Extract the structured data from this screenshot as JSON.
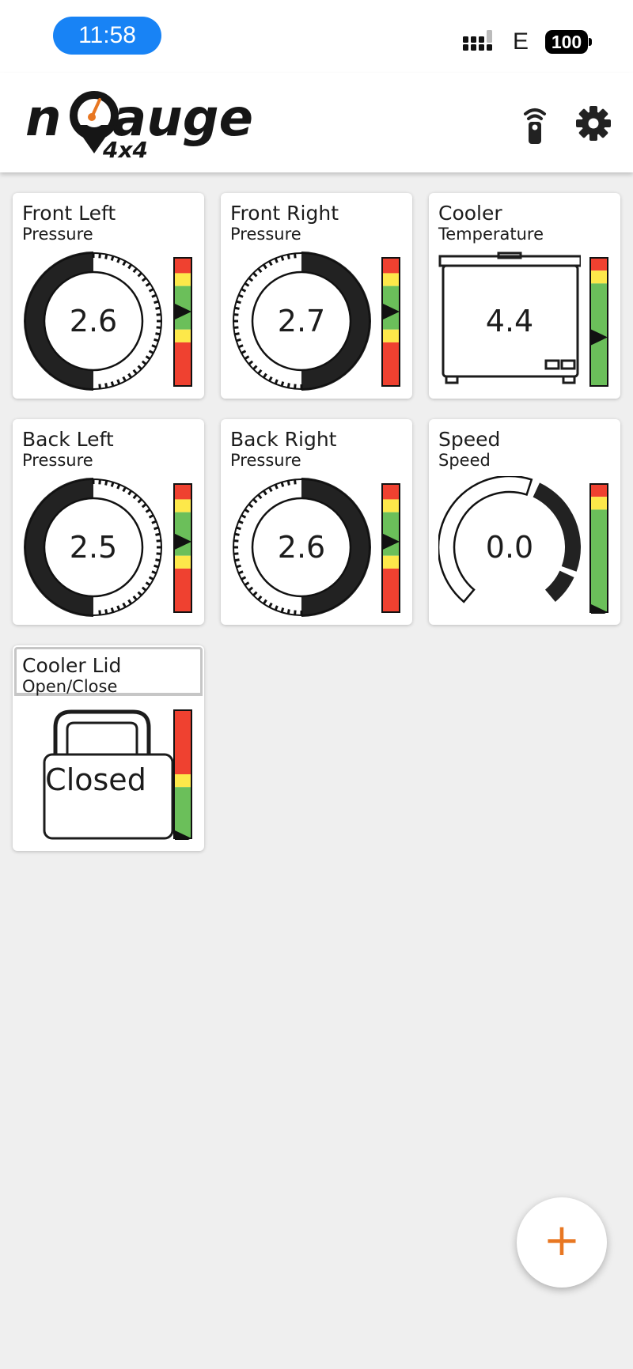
{
  "status_bar": {
    "time": "11:58",
    "network": "E",
    "battery": "100"
  },
  "app_bar": {
    "logo_text": "nGauge 4x4",
    "remote_icon": "remote-icon",
    "settings_icon": "gear-icon"
  },
  "colors": {
    "accent": "#e87722",
    "time_pill": "#1883f5",
    "scale_red": "#ef4130",
    "scale_yellow": "#fde84a",
    "scale_green": "#6bbf5a",
    "gauge_dark": "#222222"
  },
  "tiles": [
    {
      "title": "Front Left",
      "subtitle": "Pressure",
      "value": "2.6",
      "kind": "pressure",
      "arc": "left",
      "level": 0.58
    },
    {
      "title": "Front Right",
      "subtitle": "Pressure",
      "value": "2.7",
      "kind": "pressure",
      "arc": "right",
      "level": 0.58
    },
    {
      "title": "Cooler",
      "subtitle": "Temperature",
      "value": "4.4",
      "kind": "cooler",
      "level": 0.38
    },
    {
      "title": "Back Left",
      "subtitle": "Pressure",
      "value": "2.5",
      "kind": "pressure",
      "arc": "left",
      "level": 0.55
    },
    {
      "title": "Back Right",
      "subtitle": "Pressure",
      "value": "2.6",
      "kind": "pressure",
      "arc": "right",
      "level": 0.55
    },
    {
      "title": "Speed",
      "subtitle": "Speed",
      "value": "0.0",
      "kind": "speed",
      "level": 0.0
    },
    {
      "title": "Cooler Lid",
      "subtitle": "Open/Close",
      "value": "Closed",
      "kind": "lid",
      "level": 0.0
    }
  ],
  "fab": {
    "label": "+",
    "icon": "plus-icon"
  }
}
